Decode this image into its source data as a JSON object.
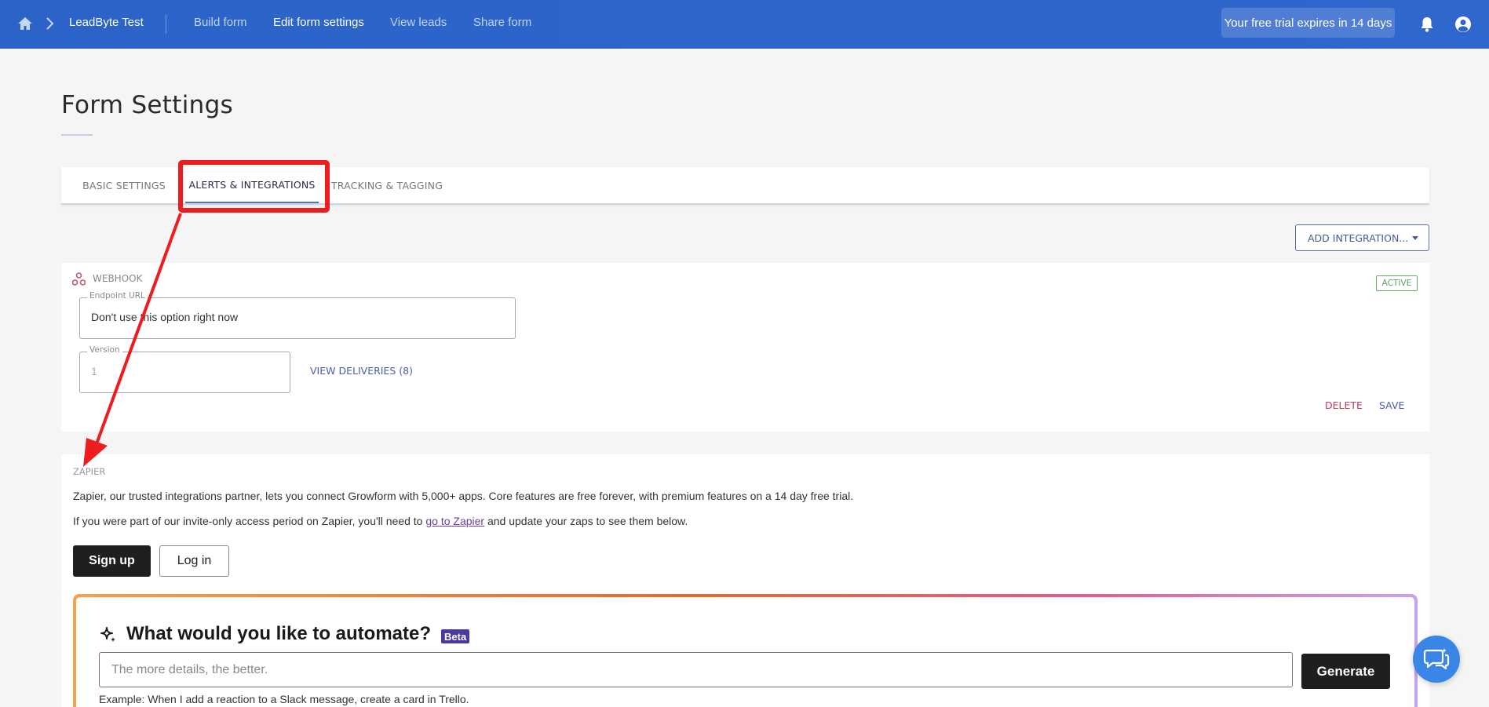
{
  "topbar": {
    "brand": "LeadByte Test",
    "nav": [
      {
        "label": "Build form",
        "active": false
      },
      {
        "label": "Edit form settings",
        "active": true
      },
      {
        "label": "View leads",
        "active": false
      },
      {
        "label": "Share form",
        "active": false
      }
    ],
    "trial": "Your free trial expires in 14 days",
    "bg_color": "#2b63c9"
  },
  "page": {
    "title": "Form Settings"
  },
  "tabs": [
    {
      "label": "BASIC SETTINGS",
      "active": false
    },
    {
      "label": "ALERTS & INTEGRATIONS",
      "active": true
    },
    {
      "label": "TRACKING & TAGGING",
      "active": false
    }
  ],
  "add_integration": "ADD INTEGRATION...",
  "webhook": {
    "label": "WEBHOOK",
    "status": "ACTIVE",
    "endpoint_label": "Endpoint URL",
    "endpoint_value": "Don't use this option right now",
    "version_label": "Version",
    "version_value": "1",
    "view_deliveries": "VIEW DELIVERIES (8)",
    "delete": "DELETE",
    "save": "SAVE"
  },
  "zapier": {
    "label": "ZAPIER",
    "intro": "Zapier, our trusted integrations partner, lets you connect Growform with 5,000+ apps. Core features are free forever, with premium features on a 14 day free trial.",
    "invite_pre": "If you were part of our invite-only access period on Zapier, you'll need to ",
    "invite_link": "go to Zapier",
    "invite_post": " and update your zaps to see them below.",
    "signup": "Sign up",
    "login": "Log in",
    "ai": {
      "title": "What would you like to automate?",
      "badge": "Beta",
      "placeholder": "The more details, the better.",
      "button": "Generate",
      "example": "Example: When I add a reaction to a Slack message, create a card in Trello."
    }
  },
  "annotation": {
    "highlight_color": "#ee1c1c"
  }
}
